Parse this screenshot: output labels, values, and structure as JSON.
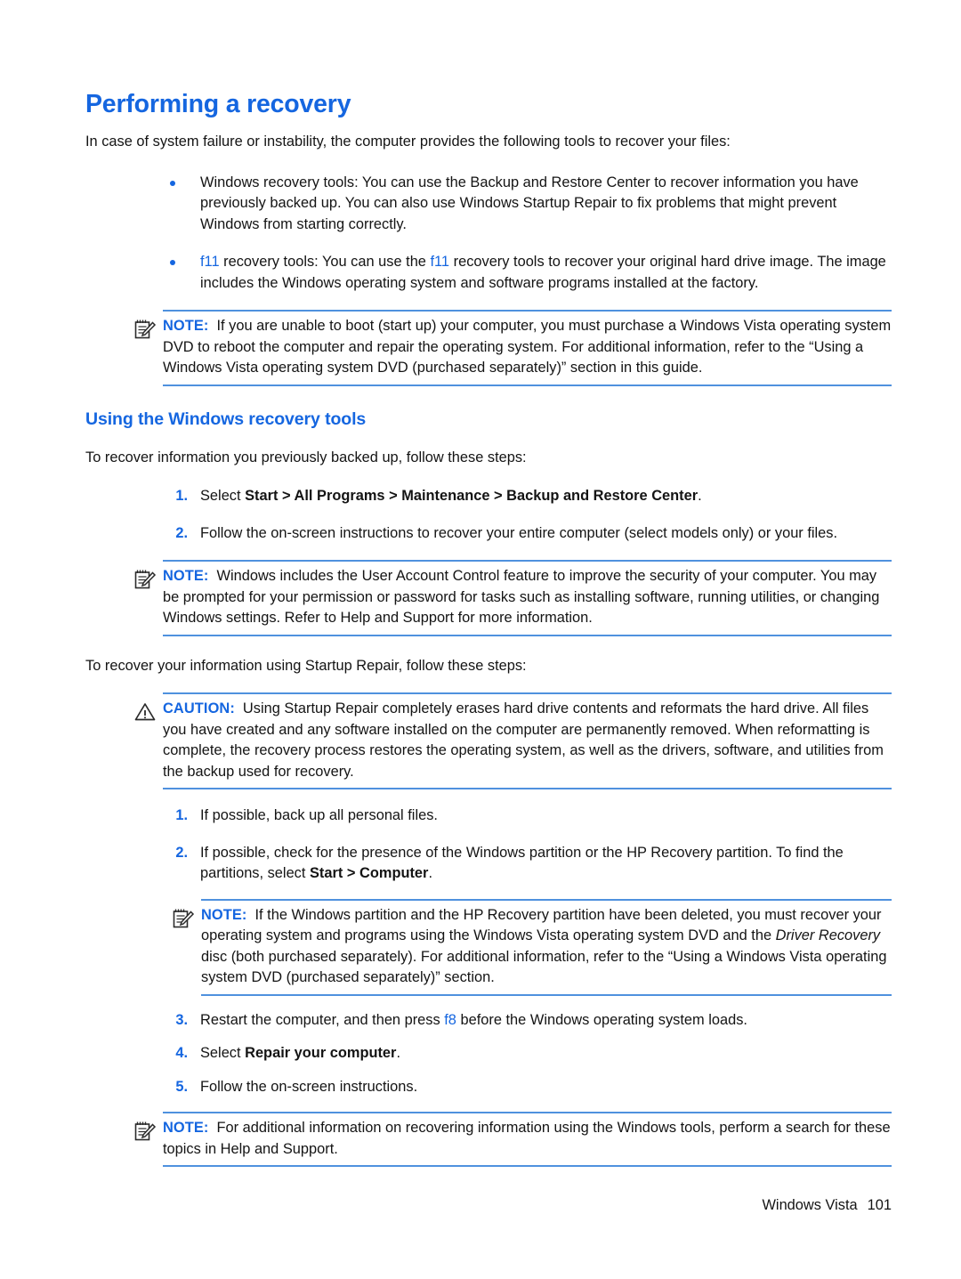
{
  "page": {
    "title": "Performing a recovery",
    "intro": "In case of system failure or instability, the computer provides the following tools to recover your files:"
  },
  "bullets": [
    {
      "icon": "bullet-dot",
      "text_parts": [
        {
          "text": "Windows recovery tools: You can use the Backup and Restore Center to recover information you have previously backed up. You can also use Windows Startup Repair to fix problems that might prevent Windows from starting correctly.",
          "style": "normal"
        }
      ],
      "plain": "Windows recovery tools: You can use the Backup and Restore Center to recover information you have previously backed up. You can also use Windows Startup Repair to fix problems that might prevent Windows from starting correctly."
    },
    {
      "icon": "bullet-dot",
      "plain": "f11 recovery tools: You can use the f11 recovery tools to recover your original hard drive image. The image includes the Windows operating system and software programs installed at the factory.",
      "seg_a": "f11",
      "seg_b": " recovery tools: You can use the ",
      "seg_c": "f11",
      "seg_d": " recovery tools to recover your original hard drive image. The image includes the Windows operating system and software programs installed at the factory."
    }
  ],
  "note_1": {
    "icon": "note-icon",
    "label": "NOTE:",
    "text": "If you are unable to boot (start up) your computer, you must purchase a Windows Vista operating system DVD to reboot the computer and repair the operating system. For additional information, refer to the “Using a Windows Vista operating system DVD (purchased separately)” section in this guide."
  },
  "section_2": {
    "heading": "Using the Windows recovery tools",
    "lead": "To recover information you previously backed up, follow these steps:",
    "steps": [
      {
        "num": "1.",
        "pre": "Select ",
        "bold": "Start > All Programs > Maintenance > Backup and Restore Center",
        "post": "."
      },
      {
        "num": "2.",
        "pre": "Follow the on-screen instructions to recover your entire computer (select models only) or your files.",
        "bold": "",
        "post": ""
      }
    ]
  },
  "note_2": {
    "icon": "note-icon",
    "label": "NOTE:",
    "text": "Windows includes the User Account Control feature to improve the security of your computer. You may be prompted for your permission or password for tasks such as installing software, running utilities, or changing Windows settings. Refer to Help and Support for more information."
  },
  "lead_startup_repair": "To recover your information using Startup Repair, follow these steps:",
  "caution_1": {
    "icon": "warning-triangle-icon",
    "label": "CAUTION:",
    "text": "Using Startup Repair completely erases hard drive contents and reformats the hard drive. All files you have created and any software installed on the computer are permanently removed. When reformatting is complete, the recovery process restores the operating system, as well as the drivers, software, and utilities from the backup used for recovery."
  },
  "steps_repair_a": [
    {
      "num": "1.",
      "pre": "If possible, back up all personal files.",
      "bold": "",
      "post": ""
    },
    {
      "num": "2.",
      "pre": "If possible, check for the presence of the Windows partition or the HP Recovery partition. To find the partitions, select ",
      "bold": "Start > Computer",
      "post": "."
    }
  ],
  "note_3": {
    "icon": "note-icon",
    "label": "NOTE:",
    "seg_1": "If the Windows partition and the HP Recovery partition have been deleted, you must recover your operating system and programs using the Windows Vista operating system DVD and the ",
    "seg_italic": "Driver Recovery",
    "seg_2": " disc (both purchased separately). For additional information, refer to the “Using a Windows Vista operating system DVD (purchased separately)” section."
  },
  "steps_repair_b": [
    {
      "num": "3.",
      "pre": "Restart the computer, and then press ",
      "key": "f8",
      "post": " before the Windows operating system loads."
    },
    {
      "num": "4.",
      "pre": "Select ",
      "bold": "Repair your computer",
      "post": "."
    },
    {
      "num": "5.",
      "pre": "Follow the on-screen instructions.",
      "bold": "",
      "post": ""
    }
  ],
  "note_4": {
    "icon": "note-icon",
    "label": "NOTE:",
    "text": "For additional information on recovering information using the Windows tools, perform a search for these topics in Help and Support."
  },
  "footer": {
    "book": "Windows Vista",
    "page_number": "101"
  },
  "colors": {
    "heading_blue": "#1566e0",
    "rule_blue": "#4f91de",
    "body_text": "#141414"
  }
}
